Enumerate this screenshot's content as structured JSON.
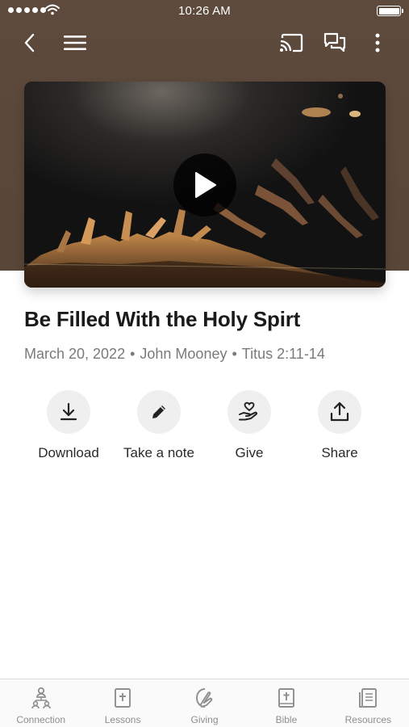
{
  "status_bar": {
    "time": "10:26 AM",
    "signal_icon": "signal-dots-icon",
    "wifi_icon": "wifi-icon",
    "battery_icon": "battery-icon",
    "battery_level": 1.0
  },
  "nav": {
    "back_icon": "chevron-left-icon",
    "menu_icon": "hamburger-menu-icon",
    "cast_icon": "cast-icon",
    "chat_icon": "chat-bubbles-icon",
    "more_icon": "more-vertical-icon"
  },
  "video": {
    "play_icon": "play-icon"
  },
  "sermon": {
    "title": "Be Filled With the Holy Spirt",
    "date": "March 20, 2022",
    "speaker": "John Mooney",
    "scripture": "Titus 2:11-14",
    "separator": "•"
  },
  "actions": [
    {
      "label": "Download",
      "icon": "download-icon"
    },
    {
      "label": "Take a note",
      "icon": "pencil-icon"
    },
    {
      "label": "Give",
      "icon": "hand-heart-icon"
    },
    {
      "label": "Share",
      "icon": "share-upload-icon"
    }
  ],
  "tabs": [
    {
      "label": "Connection",
      "icon": "people-network-icon"
    },
    {
      "label": "Lessons",
      "icon": "book-cross-icon"
    },
    {
      "label": "Giving",
      "icon": "giving-hand-icon"
    },
    {
      "label": "Bible",
      "icon": "bible-cross-icon"
    },
    {
      "label": "Resources",
      "icon": "document-stack-icon"
    }
  ],
  "colors": {
    "header_brown": "#5b4739",
    "action_circle": "#efefef",
    "tab_label": "#8e8e8e"
  }
}
